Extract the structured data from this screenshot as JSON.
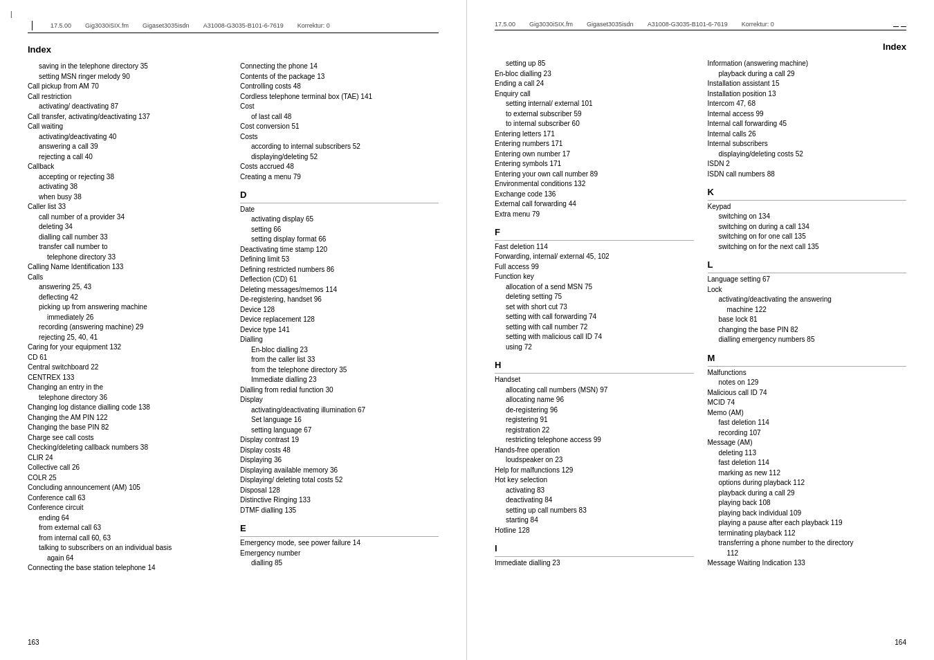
{
  "left_page": {
    "header": {
      "left_bar": true,
      "version": "17.5.00",
      "file1": "Gig3030iSIX.fm",
      "file2": "Gigaset3035isdn",
      "code": "A31008-G3035-B101-6-7619",
      "korrektur": "Korrektur: 0"
    },
    "title": "Index",
    "page_number": "163",
    "columns": {
      "col1": {
        "entries": [
          {
            "indent": 2,
            "text": "saving in the telephone directory 35"
          },
          {
            "indent": 2,
            "text": "setting MSN ringer melody 90"
          },
          {
            "indent": 0,
            "text": "Call pickup from AM 70"
          },
          {
            "indent": 0,
            "text": "Call restriction"
          },
          {
            "indent": 2,
            "text": "activating/ deactivating 87"
          },
          {
            "indent": 0,
            "text": "Call transfer, activating/deactivating 137"
          },
          {
            "indent": 0,
            "text": "Call waiting"
          },
          {
            "indent": 2,
            "text": "activating/deactivating 40"
          },
          {
            "indent": 2,
            "text": "answering a call 39"
          },
          {
            "indent": 2,
            "text": "rejecting a call 40"
          },
          {
            "indent": 0,
            "text": "Callback"
          },
          {
            "indent": 2,
            "text": "accepting or rejecting 38"
          },
          {
            "indent": 2,
            "text": "activating 38"
          },
          {
            "indent": 2,
            "text": "when busy 38"
          },
          {
            "indent": 0,
            "text": "Caller list 33"
          },
          {
            "indent": 2,
            "text": "call number of a provider 34"
          },
          {
            "indent": 2,
            "text": "deleting 34"
          },
          {
            "indent": 2,
            "text": "dialling call number 33"
          },
          {
            "indent": 2,
            "text": "transfer call number to"
          },
          {
            "indent": 3,
            "text": "telephone directory 33"
          },
          {
            "indent": 0,
            "text": "Calling Name Identification 133"
          },
          {
            "indent": 0,
            "text": "Calls"
          },
          {
            "indent": 2,
            "text": "answering 25, 43"
          },
          {
            "indent": 2,
            "text": "deflecting 42"
          },
          {
            "indent": 2,
            "text": "picking up from answering machine"
          },
          {
            "indent": 3,
            "text": "immediately 26"
          },
          {
            "indent": 2,
            "text": "recording (answering machine) 29"
          },
          {
            "indent": 2,
            "text": "rejecting 25, 40, 41"
          },
          {
            "indent": 0,
            "text": "Caring for your equipment 132"
          },
          {
            "indent": 0,
            "text": "CD 61"
          },
          {
            "indent": 0,
            "text": "Central switchboard 22"
          },
          {
            "indent": 0,
            "text": "CENTREX 133"
          },
          {
            "indent": 0,
            "text": "Changing an entry in the"
          },
          {
            "indent": 2,
            "text": "telephone directory 36"
          },
          {
            "indent": 0,
            "text": "Changing log distance dialling code 138"
          },
          {
            "indent": 0,
            "text": "Changing the AM PIN 122"
          },
          {
            "indent": 0,
            "text": "Changing the base PIN 82"
          },
          {
            "indent": 0,
            "text": "Charge  see call costs"
          },
          {
            "indent": 0,
            "text": "Checking/deleting callback numbers 38"
          },
          {
            "indent": 0,
            "text": "CLIR 24"
          },
          {
            "indent": 0,
            "text": "Collective call 26"
          },
          {
            "indent": 0,
            "text": "COLR 25"
          },
          {
            "indent": 0,
            "text": "Concluding announcement (AM) 105"
          },
          {
            "indent": 0,
            "text": "Conference call 63"
          },
          {
            "indent": 0,
            "text": "Conference circuit"
          },
          {
            "indent": 2,
            "text": "ending 64"
          },
          {
            "indent": 2,
            "text": "from external call 63"
          },
          {
            "indent": 2,
            "text": "from internal call 60, 63"
          },
          {
            "indent": 2,
            "text": "talking to subscribers on an individual basis"
          },
          {
            "indent": 3,
            "text": "again 64"
          },
          {
            "indent": 0,
            "text": "Connecting the base station telephone 14"
          }
        ]
      },
      "col2": {
        "entries": [
          {
            "indent": 0,
            "text": "Connecting the phone 14"
          },
          {
            "indent": 0,
            "text": "Contents of the package 13"
          },
          {
            "indent": 0,
            "text": "Controlling costs 48"
          },
          {
            "indent": 0,
            "text": "Cordless telephone terminal box (TAE) 141"
          },
          {
            "indent": 0,
            "text": "Cost"
          },
          {
            "indent": 2,
            "text": "of last call 48"
          },
          {
            "indent": 0,
            "text": "Cost conversion 51"
          },
          {
            "indent": 0,
            "text": "Costs"
          },
          {
            "indent": 2,
            "text": "according to internal subscribers 52"
          },
          {
            "indent": 2,
            "text": "displaying/deleting 52"
          },
          {
            "indent": 0,
            "text": "Costs accrued 48"
          },
          {
            "indent": 0,
            "text": "Creating a menu 79"
          },
          {
            "letter": "D"
          },
          {
            "indent": 0,
            "text": "Date"
          },
          {
            "indent": 2,
            "text": "activating display 65"
          },
          {
            "indent": 2,
            "text": "setting 66"
          },
          {
            "indent": 2,
            "text": "setting display format 66"
          },
          {
            "indent": 0,
            "text": "Deactivating time stamp 120"
          },
          {
            "indent": 0,
            "text": "Defining limit 53"
          },
          {
            "indent": 0,
            "text": "Defining restricted numbers 86"
          },
          {
            "indent": 0,
            "text": "Deflection (CD) 61"
          },
          {
            "indent": 0,
            "text": "Deleting messages/memos 114"
          },
          {
            "indent": 0,
            "text": "De-registering, handset 96"
          },
          {
            "indent": 0,
            "text": "Device 128"
          },
          {
            "indent": 0,
            "text": "Device replacement 128"
          },
          {
            "indent": 0,
            "text": "Device type 141"
          },
          {
            "indent": 0,
            "text": "Dialling"
          },
          {
            "indent": 2,
            "text": "En-bloc dialling 23"
          },
          {
            "indent": 2,
            "text": "from the caller list 33"
          },
          {
            "indent": 2,
            "text": "from the telephone directory 35"
          },
          {
            "indent": 2,
            "text": "Immediate dialling 23"
          },
          {
            "indent": 0,
            "text": "Dialling from redial function 30"
          },
          {
            "indent": 0,
            "text": "Display"
          },
          {
            "indent": 2,
            "text": "activating/deactivating illumination 67"
          },
          {
            "indent": 2,
            "text": "Set language 16"
          },
          {
            "indent": 2,
            "text": "setting language 67"
          },
          {
            "indent": 0,
            "text": "Display contrast 19"
          },
          {
            "indent": 0,
            "text": "Display costs 48"
          },
          {
            "indent": 0,
            "text": "Displaying 36"
          },
          {
            "indent": 0,
            "text": "Displaying available memory 36"
          },
          {
            "indent": 0,
            "text": "Displaying/ deleting total costs 52"
          },
          {
            "indent": 0,
            "text": "Disposal 128"
          },
          {
            "indent": 0,
            "text": "Distinctive Ringing 133"
          },
          {
            "indent": 0,
            "text": "DTMF dialling 135"
          },
          {
            "letter": "E"
          },
          {
            "indent": 0,
            "text": "Emergency mode, see power failure 14"
          },
          {
            "indent": 0,
            "text": "Emergency number"
          },
          {
            "indent": 2,
            "text": "dialling 85"
          }
        ]
      }
    }
  },
  "right_page": {
    "header": {
      "version": "17.5.00",
      "file1": "Gig3030iSIX.fm",
      "file2": "Gigaset3035isdn",
      "code": "A31008-G3035-B101-6-7619",
      "korrektur": "Korrektur: 0"
    },
    "title": "Index",
    "page_number": "164",
    "columns": {
      "col1": {
        "entries": [
          {
            "indent": 2,
            "text": "setting up 85"
          },
          {
            "indent": 0,
            "text": "En-bloc dialling 23"
          },
          {
            "indent": 0,
            "text": "Ending a call 24"
          },
          {
            "indent": 0,
            "text": "Enquiry call"
          },
          {
            "indent": 2,
            "text": "setting internal/ external 101"
          },
          {
            "indent": 2,
            "text": "to external subscriber 59"
          },
          {
            "indent": 2,
            "text": "to internal subscriber 60"
          },
          {
            "indent": 0,
            "text": "Entering letters 171"
          },
          {
            "indent": 0,
            "text": "Entering numbers 171"
          },
          {
            "indent": 0,
            "text": "Entering own number 17"
          },
          {
            "indent": 0,
            "text": "Entering symbols 171"
          },
          {
            "indent": 0,
            "text": "Entering your own call number 89"
          },
          {
            "indent": 0,
            "text": "Environmental conditions 132"
          },
          {
            "indent": 0,
            "text": "Exchange code 136"
          },
          {
            "indent": 0,
            "text": "External call forwarding 44"
          },
          {
            "indent": 0,
            "text": "Extra menu 79"
          },
          {
            "letter": "F"
          },
          {
            "indent": 0,
            "text": "Fast deletion 114"
          },
          {
            "indent": 0,
            "text": "Forwarding, internal/ external 45, 102"
          },
          {
            "indent": 0,
            "text": "Full access 99"
          },
          {
            "indent": 0,
            "text": "Function key"
          },
          {
            "indent": 2,
            "text": "allocation of a send MSN 75"
          },
          {
            "indent": 2,
            "text": "deleting setting 75"
          },
          {
            "indent": 2,
            "text": "set with short cut 73"
          },
          {
            "indent": 2,
            "text": "setting with call forwarding 74"
          },
          {
            "indent": 2,
            "text": "setting with call number 72"
          },
          {
            "indent": 2,
            "text": "setting with malicious call ID 74"
          },
          {
            "indent": 2,
            "text": "using 72"
          },
          {
            "letter": "H"
          },
          {
            "indent": 0,
            "text": "Handset"
          },
          {
            "indent": 2,
            "text": "allocating call numbers (MSN) 97"
          },
          {
            "indent": 2,
            "text": "allocating name 96"
          },
          {
            "indent": 2,
            "text": "de-registering 96"
          },
          {
            "indent": 2,
            "text": "registering 91"
          },
          {
            "indent": 2,
            "text": "registration 22"
          },
          {
            "indent": 2,
            "text": "restricting telephone access 99"
          },
          {
            "indent": 0,
            "text": "Hands-free operation"
          },
          {
            "indent": 2,
            "text": "loudspeaker on 23"
          },
          {
            "indent": 0,
            "text": "Help for malfunctions 129"
          },
          {
            "indent": 0,
            "text": "Hot key selection"
          },
          {
            "indent": 2,
            "text": "activating 83"
          },
          {
            "indent": 2,
            "text": "deactivating 84"
          },
          {
            "indent": 2,
            "text": "setting up call numbers 83"
          },
          {
            "indent": 2,
            "text": "starting 84"
          },
          {
            "indent": 0,
            "text": "Hotline 128"
          },
          {
            "letter": "I"
          },
          {
            "indent": 0,
            "text": "Immediate dialling 23"
          }
        ]
      },
      "col2": {
        "entries": [
          {
            "indent": 0,
            "text": "Information (answering machine)"
          },
          {
            "indent": 2,
            "text": "playback during a call 29"
          },
          {
            "indent": 0,
            "text": "Installation assistant 15"
          },
          {
            "indent": 0,
            "text": "Installation position 13"
          },
          {
            "indent": 0,
            "text": "Intercom 47, 68"
          },
          {
            "indent": 0,
            "text": "Internal access 99"
          },
          {
            "indent": 0,
            "text": "Internal call forwarding 45"
          },
          {
            "indent": 0,
            "text": "Internal calls 26"
          },
          {
            "indent": 0,
            "text": "Internal subscribers"
          },
          {
            "indent": 2,
            "text": "displaying/deleting costs 52"
          },
          {
            "indent": 0,
            "text": "ISDN 2"
          },
          {
            "indent": 0,
            "text": "ISDN call numbers 88"
          },
          {
            "letter": "K"
          },
          {
            "indent": 0,
            "text": "Keypad"
          },
          {
            "indent": 2,
            "text": "switching on 134"
          },
          {
            "indent": 2,
            "text": "switching on during a call 134"
          },
          {
            "indent": 2,
            "text": "switching on for one call 135"
          },
          {
            "indent": 2,
            "text": "switching on for the next call 135"
          },
          {
            "letter": "L"
          },
          {
            "indent": 0,
            "text": "Language setting 67"
          },
          {
            "indent": 0,
            "text": "Lock"
          },
          {
            "indent": 2,
            "text": "activating/deactivating the answering"
          },
          {
            "indent": 3,
            "text": "machine 122"
          },
          {
            "indent": 2,
            "text": "base lock 81"
          },
          {
            "indent": 2,
            "text": "changing the base PIN 82"
          },
          {
            "indent": 2,
            "text": "dialling emergency numbers 85"
          },
          {
            "letter": "M"
          },
          {
            "indent": 0,
            "text": "Malfunctions"
          },
          {
            "indent": 2,
            "text": "notes on 129"
          },
          {
            "indent": 0,
            "text": "Malicious call ID 74"
          },
          {
            "indent": 0,
            "text": "MCID 74"
          },
          {
            "indent": 0,
            "text": "Memo (AM)"
          },
          {
            "indent": 2,
            "text": "fast deletion 114"
          },
          {
            "indent": 2,
            "text": "recording 107"
          },
          {
            "indent": 0,
            "text": "Message (AM)"
          },
          {
            "indent": 2,
            "text": "deleting 113"
          },
          {
            "indent": 2,
            "text": "fast deletion 114"
          },
          {
            "indent": 2,
            "text": "marking as new 112"
          },
          {
            "indent": 2,
            "text": "options during playback 112"
          },
          {
            "indent": 2,
            "text": "playback during a call 29"
          },
          {
            "indent": 2,
            "text": "playing back 108"
          },
          {
            "indent": 2,
            "text": "playing back individual 109"
          },
          {
            "indent": 2,
            "text": "playing a pause after each playback 119"
          },
          {
            "indent": 2,
            "text": "terminating playback 112"
          },
          {
            "indent": 2,
            "text": "transferring a phone number to the directory"
          },
          {
            "indent": 3,
            "text": "112"
          },
          {
            "indent": 0,
            "text": "Message Waiting Indication 133"
          }
        ]
      }
    }
  }
}
